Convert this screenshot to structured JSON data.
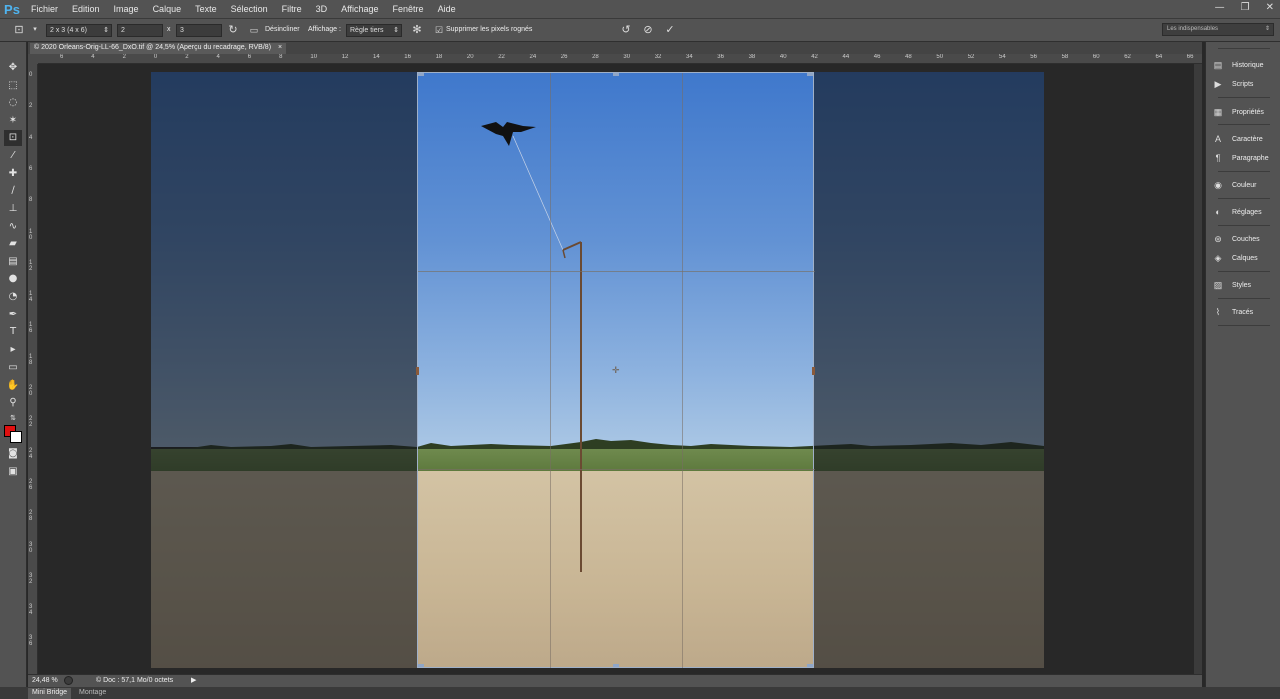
{
  "app": {
    "logo": "Ps"
  },
  "menu": [
    "Fichier",
    "Edition",
    "Image",
    "Calque",
    "Texte",
    "Sélection",
    "Filtre",
    "3D",
    "Affichage",
    "Fenêtre",
    "Aide"
  ],
  "window_controls": {
    "minimize": "—",
    "maximize": "❐",
    "close": "✕"
  },
  "options": {
    "ratio_preset": "2 x 3 (4 x 6)",
    "width_value": "2",
    "times": "x",
    "height_value": "3",
    "straighten_label": "Désincliner",
    "view_label": "Affichage :",
    "view_value": "Règle tiers",
    "delete_cropped_label": "Supprimer les pixels rognés",
    "delete_cropped_checked": true
  },
  "workspace": "Les indispensables",
  "document_tab": {
    "title": "© 2020 Orleans-Orig-LL-66_DxO.tif @ 24,5% (Aperçu du recadrage, RVB/8)",
    "close": "×"
  },
  "ruler_top": [
    "6",
    "4",
    "2",
    "0",
    "2",
    "4",
    "6",
    "8",
    "10",
    "12",
    "14",
    "16",
    "18",
    "20",
    "22",
    "24",
    "26",
    "28",
    "30",
    "32",
    "34",
    "36",
    "38",
    "40",
    "42",
    "44",
    "46",
    "48",
    "50",
    "52",
    "54",
    "56",
    "58",
    "60",
    "62",
    "64",
    "66"
  ],
  "ruler_left": [
    "0",
    "2",
    "4",
    "6",
    "8",
    "1\n0",
    "1\n2",
    "1\n4",
    "1\n6",
    "1\n8",
    "2\n0",
    "2\n2",
    "2\n4",
    "2\n6",
    "2\n8",
    "3\n0",
    "3\n2",
    "3\n4",
    "3\n6"
  ],
  "status": {
    "zoom": "24,48 %",
    "doc_info": "© Doc : 57,1 Mo/0 octets"
  },
  "bottom_tabs": [
    "Mini Bridge",
    "Montage"
  ],
  "panels": [
    {
      "label": "Historique",
      "icon": "history-icon"
    },
    {
      "label": "Scripts",
      "icon": "play-icon"
    },
    {
      "label": "Propriétés",
      "icon": "properties-icon"
    },
    {
      "label": "Caractère",
      "icon": "character-icon"
    },
    {
      "label": "Paragraphe",
      "icon": "paragraph-icon"
    },
    {
      "label": "Couleur",
      "icon": "color-icon"
    },
    {
      "label": "Réglages",
      "icon": "adjustments-icon"
    },
    {
      "label": "Couches",
      "icon": "channels-icon"
    },
    {
      "label": "Calques",
      "icon": "layers-icon"
    },
    {
      "label": "Styles",
      "icon": "styles-icon"
    },
    {
      "label": "Tracés",
      "icon": "paths-icon"
    }
  ],
  "colors": {
    "foreground": "#e01010",
    "background": "#ffffff",
    "accent": "#4fb4f0"
  }
}
